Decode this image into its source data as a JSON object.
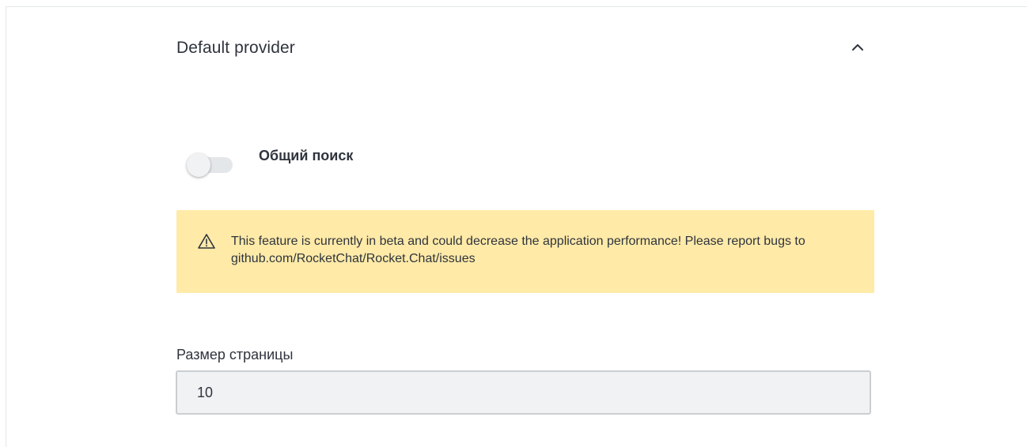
{
  "section": {
    "title": "Default provider",
    "collapse_icon": "chevron-up-icon"
  },
  "global_search": {
    "label": "Общий поиск",
    "enabled": false
  },
  "beta_callout": {
    "icon": "warning-icon",
    "text": "This feature is currently in beta and could decrease the application performance! Please report bugs to github.com/RocketChat/Rocket.Chat/issues",
    "background_color": "#ffeaa8"
  },
  "page_size": {
    "label": "Размер страницы",
    "value": "10"
  }
}
